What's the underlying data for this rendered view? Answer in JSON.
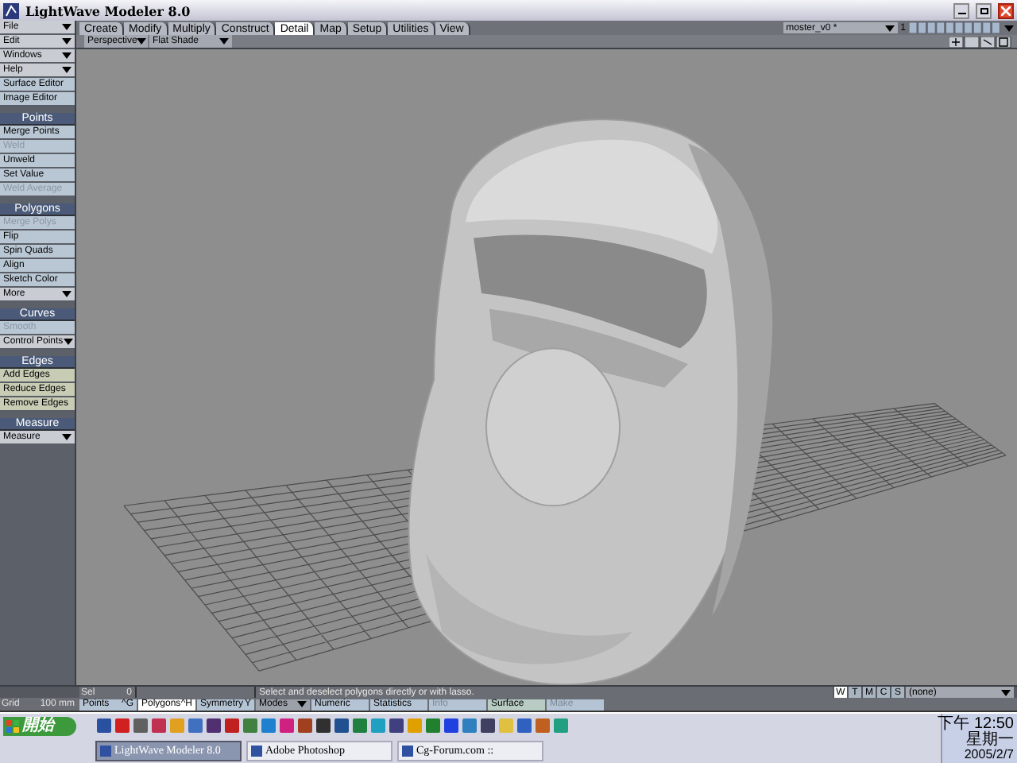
{
  "window": {
    "title": "LightWave Modeler 8.0"
  },
  "sidebar": [
    {
      "items": [
        {
          "label": "File",
          "kind": "menu",
          "disabled": false
        },
        {
          "label": "Edit",
          "kind": "menu",
          "disabled": false
        },
        {
          "label": "Windows",
          "kind": "menu",
          "disabled": false
        },
        {
          "label": "Help",
          "kind": "menu",
          "disabled": false
        },
        {
          "label": "Surface Editor",
          "kind": "button",
          "disabled": false
        },
        {
          "label": "Image Editor",
          "kind": "button",
          "disabled": false
        }
      ]
    },
    {
      "header": "Points",
      "items": [
        {
          "label": "Merge Points",
          "kind": "button",
          "disabled": false
        },
        {
          "label": "Weld",
          "kind": "button",
          "disabled": true
        },
        {
          "label": "Unweld",
          "kind": "button",
          "disabled": false
        },
        {
          "label": "Set Value",
          "kind": "button",
          "disabled": false
        },
        {
          "label": "Weld Average",
          "kind": "button",
          "disabled": true
        }
      ]
    },
    {
      "header": "Polygons",
      "items": [
        {
          "label": "Merge Polys",
          "kind": "button",
          "disabled": true
        },
        {
          "label": "Flip",
          "kind": "button",
          "disabled": false
        },
        {
          "label": "Spin Quads",
          "kind": "button",
          "disabled": false
        },
        {
          "label": "Align",
          "kind": "button",
          "disabled": false
        },
        {
          "label": "Sketch Color",
          "kind": "button",
          "disabled": false
        },
        {
          "label": "More",
          "kind": "menu",
          "disabled": false
        }
      ]
    },
    {
      "header": "Curves",
      "items": [
        {
          "label": "Smooth",
          "kind": "button",
          "disabled": true
        },
        {
          "label": "Control Points",
          "kind": "menu",
          "disabled": false
        }
      ]
    },
    {
      "header": "Edges",
      "items": [
        {
          "label": "Add Edges",
          "kind": "button",
          "disabled": false
        },
        {
          "label": "Reduce Edges",
          "kind": "button",
          "disabled": false
        },
        {
          "label": "Remove Edges",
          "kind": "button",
          "disabled": false
        }
      ]
    },
    {
      "header": "Measure",
      "items": [
        {
          "label": "Measure",
          "kind": "menu",
          "disabled": false
        }
      ]
    }
  ],
  "tabs": [
    {
      "label": "Create",
      "selected": false
    },
    {
      "label": "Modify",
      "selected": false
    },
    {
      "label": "Multiply",
      "selected": false
    },
    {
      "label": "Construct",
      "selected": false
    },
    {
      "label": "Detail",
      "selected": true
    },
    {
      "label": "Map",
      "selected": false
    },
    {
      "label": "Setup",
      "selected": false
    },
    {
      "label": "Utilities",
      "selected": false
    },
    {
      "label": "View",
      "selected": false
    }
  ],
  "object_selector": {
    "value": "moster_v0 *",
    "layer_bank": "1"
  },
  "viewport": {
    "view": "Perspective",
    "shading": "Flat Shade"
  },
  "status_bar": {
    "sel_label": "Sel",
    "sel_count": "0",
    "message": "Select and deselect polygons directly or with lasso.",
    "map_buttons": [
      {
        "label": "W",
        "selected": true
      },
      {
        "label": "T",
        "selected": false
      },
      {
        "label": "M",
        "selected": false
      },
      {
        "label": "C",
        "selected": false
      },
      {
        "label": "S",
        "selected": false
      }
    ],
    "vmap": "(none)",
    "grid_label": "Grid",
    "grid_value": "100 mm",
    "modes": [
      {
        "label": "Points",
        "shortcut": "^G",
        "selected": false
      },
      {
        "label": "Polygons",
        "shortcut": "^H",
        "selected": true
      },
      {
        "label": "Symmetry",
        "shortcut": "Y",
        "selected": false
      }
    ],
    "mode_menu": "Modes",
    "panels": [
      {
        "label": "Numeric",
        "disabled": false
      },
      {
        "label": "Statistics",
        "disabled": false
      },
      {
        "label": "Info",
        "disabled": true
      },
      {
        "label": "Surface",
        "disabled": false
      },
      {
        "label": "Make",
        "disabled": true
      }
    ]
  },
  "taskbar": {
    "start": "開始",
    "tasks": [
      {
        "label": "LightWave Modeler 8.0",
        "selected": true
      },
      {
        "label": "Adobe Photoshop",
        "selected": false
      },
      {
        "label": "Cg-Forum.com ::",
        "selected": false
      }
    ],
    "clock": {
      "time": "下午 12:50",
      "weekday": "星期一",
      "date": "2005/2/7"
    }
  }
}
